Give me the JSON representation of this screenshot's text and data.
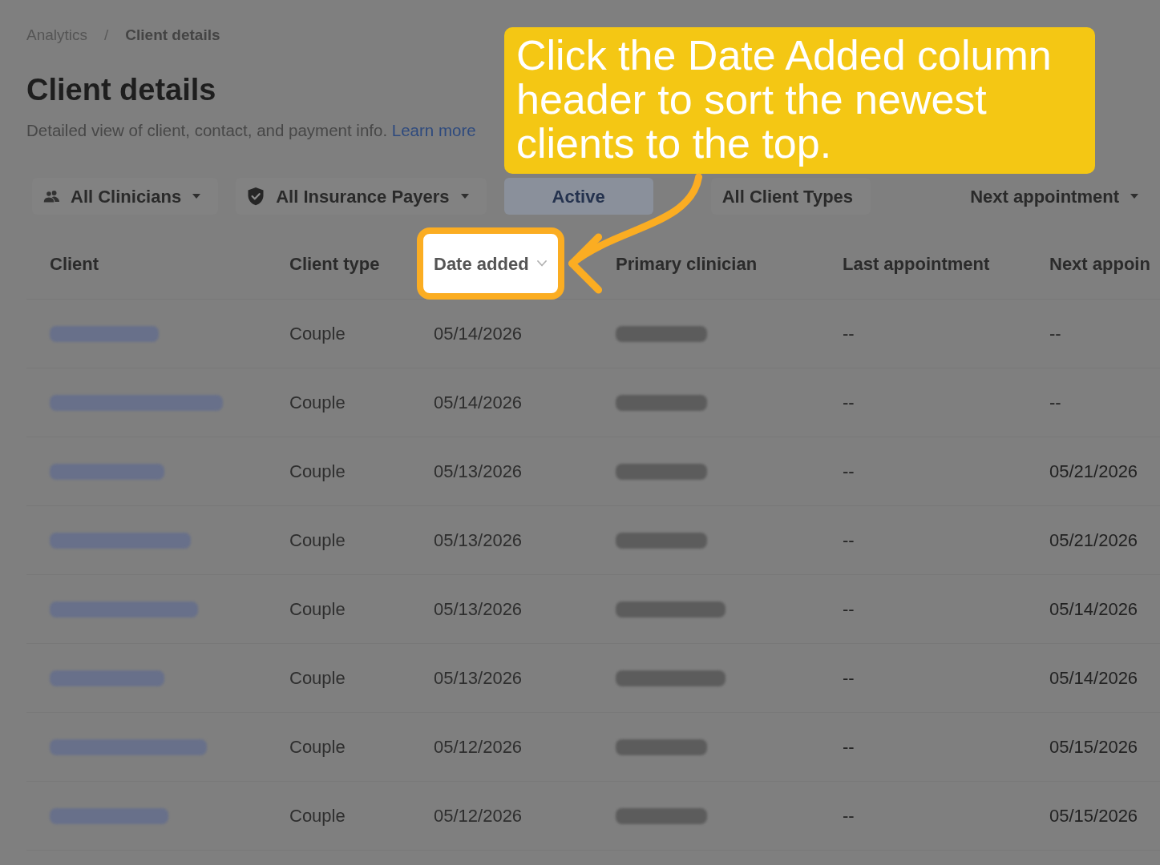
{
  "breadcrumb": {
    "separator": "/",
    "items": [
      {
        "label": "Analytics",
        "current": false
      },
      {
        "label": "Client details",
        "current": true
      }
    ]
  },
  "page": {
    "title": "Client details",
    "description": "Detailed view of client, contact, and payment info.",
    "link": "Learn more"
  },
  "filters": [
    {
      "kind": "clinician",
      "label": "All Clinicians",
      "selected": false,
      "dropdown": true
    },
    {
      "kind": "insurance",
      "label": "All Insurance Payers",
      "selected": false,
      "dropdown": true
    },
    {
      "kind": "status",
      "label": "Active",
      "selected": true,
      "dropdown": false
    },
    {
      "kind": "client_type",
      "label": "All Client Types",
      "selected": false,
      "dropdown": false
    },
    {
      "kind": "sort",
      "label": "Next appointment",
      "selected": false,
      "dropdown": true
    }
  ],
  "table": {
    "columns": [
      {
        "label": "Client",
        "highlighted": false,
        "sort_indicator": false
      },
      {
        "label": "Client type",
        "highlighted": false,
        "sort_indicator": false
      },
      {
        "label": "Date added",
        "highlighted": true,
        "sort_indicator": true
      },
      {
        "label": "Primary clinician",
        "highlighted": false,
        "sort_indicator": false
      },
      {
        "label": "Last appointment",
        "highlighted": false,
        "sort_indicator": false
      },
      {
        "label": "Next appoin",
        "highlighted": false,
        "sort_indicator": false
      }
    ],
    "rows": [
      {
        "client_type": "Couple",
        "date_added": "05/14/2026",
        "last_appointment": "--",
        "next_appointment": "--"
      },
      {
        "client_type": "Couple",
        "date_added": "05/14/2026",
        "last_appointment": "--",
        "next_appointment": "--"
      },
      {
        "client_type": "Couple",
        "date_added": "05/13/2026",
        "last_appointment": "--",
        "next_appointment": "05/21/2026"
      },
      {
        "client_type": "Couple",
        "date_added": "05/13/2026",
        "last_appointment": "--",
        "next_appointment": "05/21/2026"
      },
      {
        "client_type": "Couple",
        "date_added": "05/13/2026",
        "last_appointment": "--",
        "next_appointment": "05/14/2026"
      },
      {
        "client_type": "Couple",
        "date_added": "05/13/2026",
        "last_appointment": "--",
        "next_appointment": "05/14/2026"
      },
      {
        "client_type": "Couple",
        "date_added": "05/12/2026",
        "last_appointment": "--",
        "next_appointment": "05/15/2026"
      },
      {
        "client_type": "Couple",
        "date_added": "05/12/2026",
        "last_appointment": "--",
        "next_appointment": "05/15/2026"
      }
    ]
  },
  "callout": {
    "text": "Click the Date Added column header to sort the newest clients to the top."
  }
}
